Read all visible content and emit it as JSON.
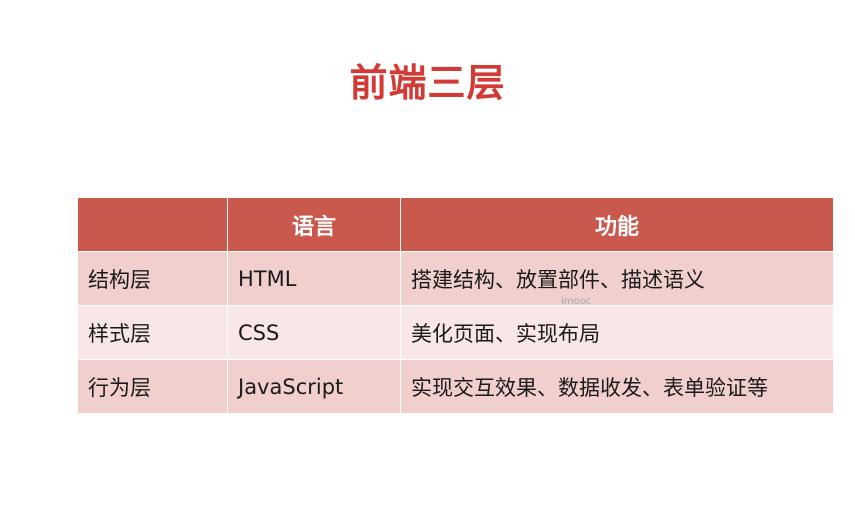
{
  "slide": {
    "title": "前端三层",
    "watermark": "imooc"
  },
  "table": {
    "headers": [
      "",
      "语言",
      "功能"
    ],
    "rows": [
      [
        "结构层",
        "HTML",
        "搭建结构、放置部件、描述语义"
      ],
      [
        "样式层",
        "CSS",
        "美化页面、实现布局"
      ],
      [
        "行为层",
        "JavaScript",
        "实现交互效果、数据收发、表单验证等"
      ]
    ]
  },
  "colors": {
    "title": "#d23a35",
    "header_bg": "#c9584d",
    "row_odd_bg": "#f0cfcd",
    "row_even_bg": "#f8e7e6"
  }
}
